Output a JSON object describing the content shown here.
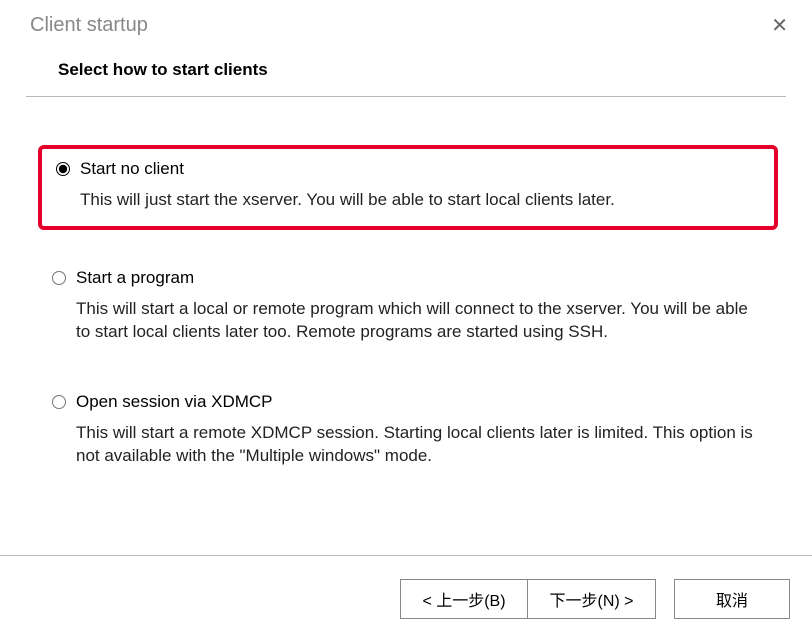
{
  "window": {
    "title": "Client startup"
  },
  "header": {
    "title": "Select how to start clients"
  },
  "options": [
    {
      "label": "Start no client",
      "description": "This will just start the xserver. You will be able to start local clients later.",
      "selected": true,
      "highlighted": true
    },
    {
      "label": "Start a program",
      "description": "This will start a local or remote program which will connect to the xserver. You will be able to start local clients later too. Remote programs are started using SSH.",
      "selected": false,
      "highlighted": false
    },
    {
      "label": "Open session via XDMCP",
      "description": "This will start a remote XDMCP session. Starting local clients later is limited. This option is not available with the \"Multiple windows\" mode.",
      "selected": false,
      "highlighted": false
    }
  ],
  "buttons": {
    "back": "< 上一步(B)",
    "next": "下一步(N) >",
    "cancel": "取消"
  }
}
